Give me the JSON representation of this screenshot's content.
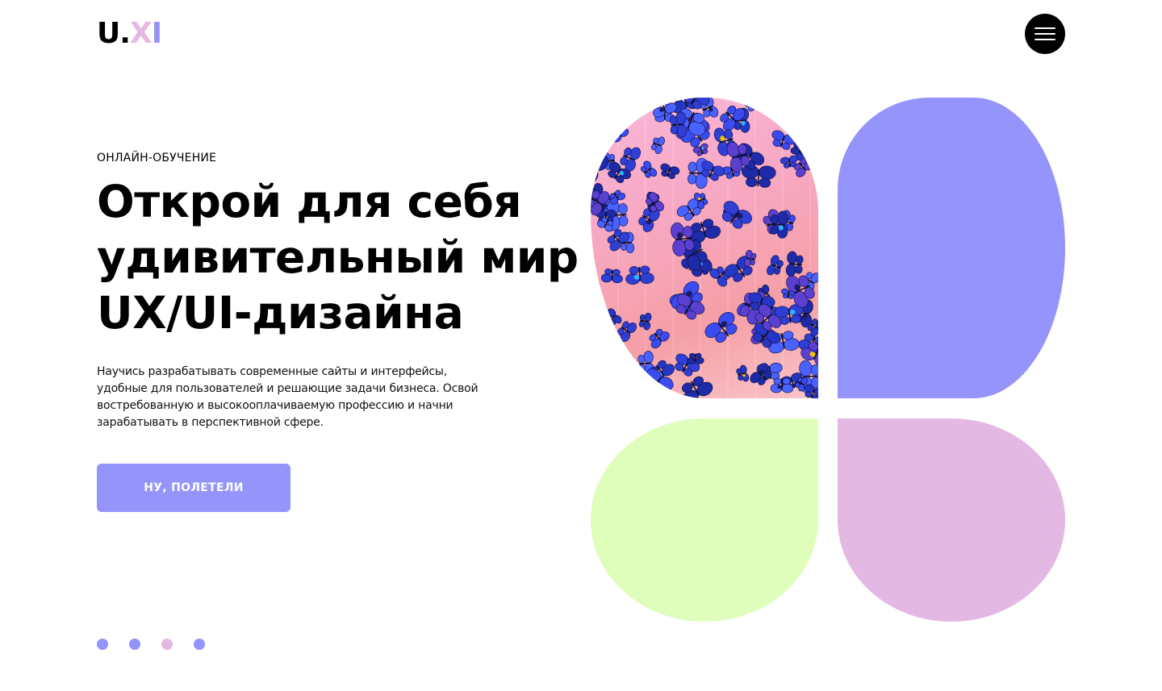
{
  "header": {
    "logo": {
      "part1": "U.",
      "part2": "X",
      "part3": "I"
    },
    "menu_icon": "hamburger-menu-icon"
  },
  "hero": {
    "eyebrow": "ОНЛАЙН-ОБУЧЕНИЕ",
    "headline_lines": [
      "Открой для себя",
      "удивительный мир",
      "UX/UI-дизайна"
    ],
    "description": "Научись разрабатывать современные сайты и интерфейсы, удобные для пользователей и решающие задачи бизнеса. Освой востребованную и высокооплачиваемую профессию и начни зарабатывать в перспективной сфере.",
    "cta_label": "НУ, ПОЛЕТЕЛИ"
  },
  "slider": {
    "dots": [
      {
        "color": "#9494fb"
      },
      {
        "color": "#9494fb"
      },
      {
        "color": "#e3b8e3"
      },
      {
        "color": "#9494fb"
      }
    ]
  },
  "petals": {
    "top_left": {
      "type": "image",
      "description_icon": "butterflies-photo"
    },
    "top_right": {
      "color": "#9494fb"
    },
    "bottom_left": {
      "color": "#dffdbb"
    },
    "bottom_right": {
      "color": "#e3b8e3"
    }
  },
  "colors": {
    "accent": "#9494fb",
    "pink": "#e3b8e3",
    "lime": "#dffdbb",
    "dark": "#000000"
  }
}
